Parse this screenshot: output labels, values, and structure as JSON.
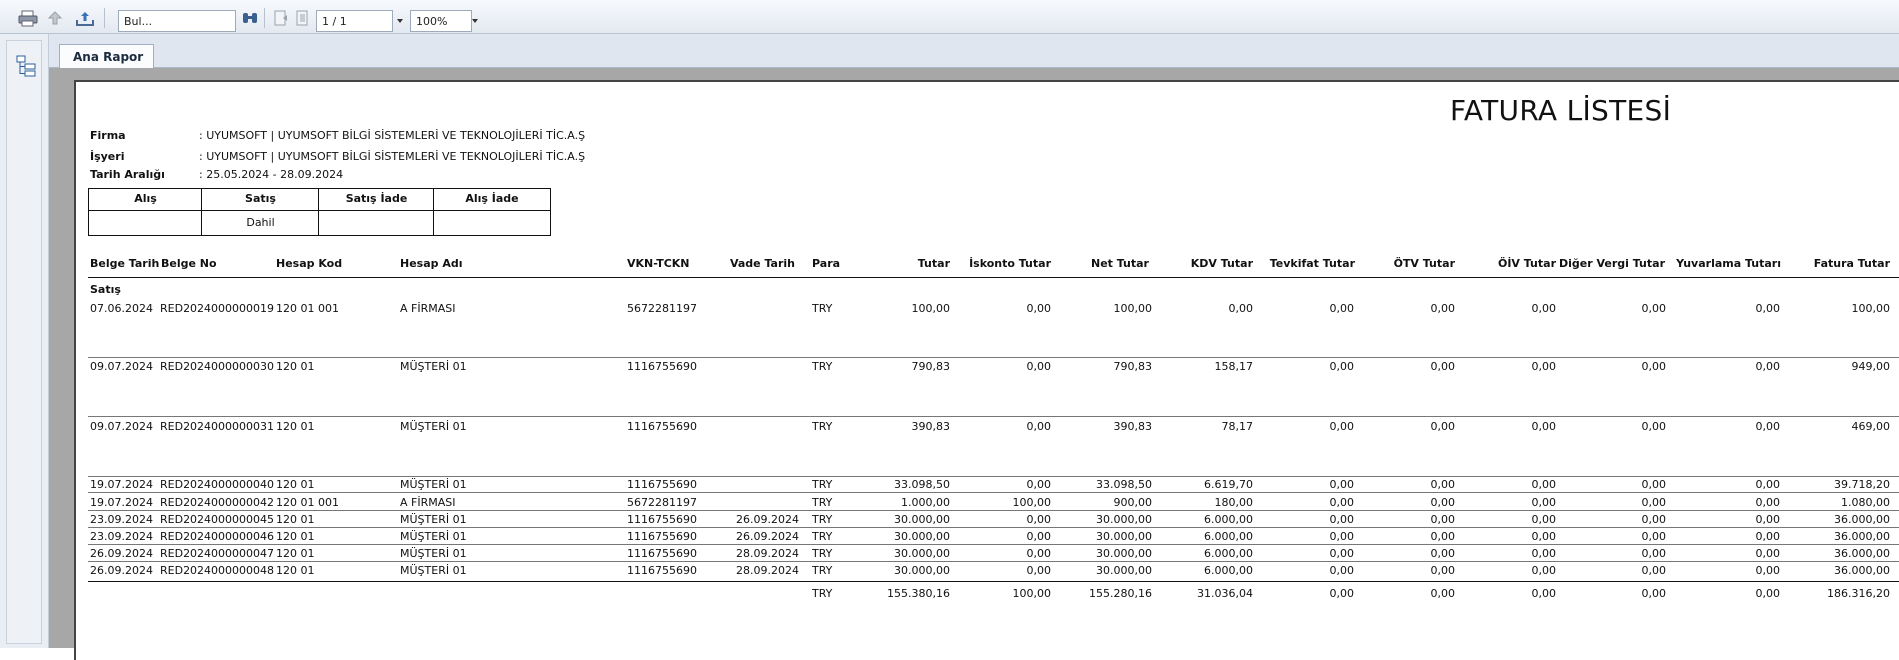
{
  "toolbar": {
    "search_value": "Bul...",
    "page_value": "1 / 1",
    "zoom_value": "100%"
  },
  "tabs": [
    {
      "label": "Ana Rapor"
    }
  ],
  "report": {
    "title": "FATURA LİSTESİ",
    "firma_label": "Firma",
    "firma_value": ": UYUMSOFT | UYUMSOFT BİLGİ SİSTEMLERİ VE TEKNOLOJİLERİ TİC.A.Ş",
    "isyeri_label": "İşyeri",
    "isyeri_value": ": UYUMSOFT | UYUMSOFT BİLGİ SİSTEMLERİ VE TEKNOLOJİLERİ TİC.A.Ş",
    "tarih_label": "Tarih Aralığı",
    "tarih_value": ": 25.05.2024 - 28.09.2024",
    "filter": {
      "headers": [
        "Alış",
        "Satış",
        "Satış İade",
        "Alış İade"
      ],
      "values": [
        "",
        "Dahil",
        "",
        ""
      ]
    },
    "columns": [
      "Belge Tarih",
      "Belge No",
      "Hesap Kod",
      "Hesap Adı",
      "VKN-TCKN",
      "Vade Tarih",
      "Para",
      "Tutar",
      "İskonto Tutar",
      "Net Tutar",
      "KDV Tutar",
      "Tevkifat Tutar",
      "ÖTV Tutar",
      "ÖİV Tutar",
      "Diğer Vergi Tutar",
      "Yuvarlama Tutarı",
      "Fatura Tutar"
    ],
    "group_label": "Satış",
    "rows": [
      [
        "07.06.2024",
        "RED2024000000019",
        "120 01 001",
        "A FİRMASI",
        "5672281197",
        "",
        "TRY",
        "100,00",
        "0,00",
        "100,00",
        "0,00",
        "0,00",
        "0,00",
        "0,00",
        "0,00",
        "0,00",
        "100,00"
      ],
      [
        "09.07.2024",
        "RED2024000000030",
        "120 01",
        "MÜŞTERİ 01",
        "1116755690",
        "",
        "TRY",
        "790,83",
        "0,00",
        "790,83",
        "158,17",
        "0,00",
        "0,00",
        "0,00",
        "0,00",
        "0,00",
        "949,00"
      ],
      [
        "09.07.2024",
        "RED2024000000031",
        "120 01",
        "MÜŞTERİ 01",
        "1116755690",
        "",
        "TRY",
        "390,83",
        "0,00",
        "390,83",
        "78,17",
        "0,00",
        "0,00",
        "0,00",
        "0,00",
        "0,00",
        "469,00"
      ],
      [
        "19.07.2024",
        "RED2024000000040",
        "120 01",
        "MÜŞTERİ 01",
        "1116755690",
        "",
        "TRY",
        "33.098,50",
        "0,00",
        "33.098,50",
        "6.619,70",
        "0,00",
        "0,00",
        "0,00",
        "0,00",
        "0,00",
        "39.718,20"
      ],
      [
        "19.07.2024",
        "RED2024000000042",
        "120 01 001",
        "A FİRMASI",
        "5672281197",
        "",
        "TRY",
        "1.000,00",
        "100,00",
        "900,00",
        "180,00",
        "0,00",
        "0,00",
        "0,00",
        "0,00",
        "0,00",
        "1.080,00"
      ],
      [
        "23.09.2024",
        "RED2024000000045",
        "120 01",
        "MÜŞTERİ 01",
        "1116755690",
        "26.09.2024",
        "TRY",
        "30.000,00",
        "0,00",
        "30.000,00",
        "6.000,00",
        "0,00",
        "0,00",
        "0,00",
        "0,00",
        "0,00",
        "36.000,00"
      ],
      [
        "23.09.2024",
        "RED2024000000046",
        "120 01",
        "MÜŞTERİ 01",
        "1116755690",
        "26.09.2024",
        "TRY",
        "30.000,00",
        "0,00",
        "30.000,00",
        "6.000,00",
        "0,00",
        "0,00",
        "0,00",
        "0,00",
        "0,00",
        "36.000,00"
      ],
      [
        "26.09.2024",
        "RED2024000000047",
        "120 01",
        "MÜŞTERİ 01",
        "1116755690",
        "28.09.2024",
        "TRY",
        "30.000,00",
        "0,00",
        "30.000,00",
        "6.000,00",
        "0,00",
        "0,00",
        "0,00",
        "0,00",
        "0,00",
        "36.000,00"
      ],
      [
        "26.09.2024",
        "RED2024000000048",
        "120 01",
        "MÜŞTERİ 01",
        "1116755690",
        "28.09.2024",
        "TRY",
        "30.000,00",
        "0,00",
        "30.000,00",
        "6.000,00",
        "0,00",
        "0,00",
        "0,00",
        "0,00",
        "0,00",
        "36.000,00"
      ]
    ],
    "totals": [
      "TRY",
      "155.380,16",
      "100,00",
      "155.280,16",
      "31.036,04",
      "0,00",
      "0,00",
      "0,00",
      "0,00",
      "0,00",
      "186.316,20"
    ]
  }
}
